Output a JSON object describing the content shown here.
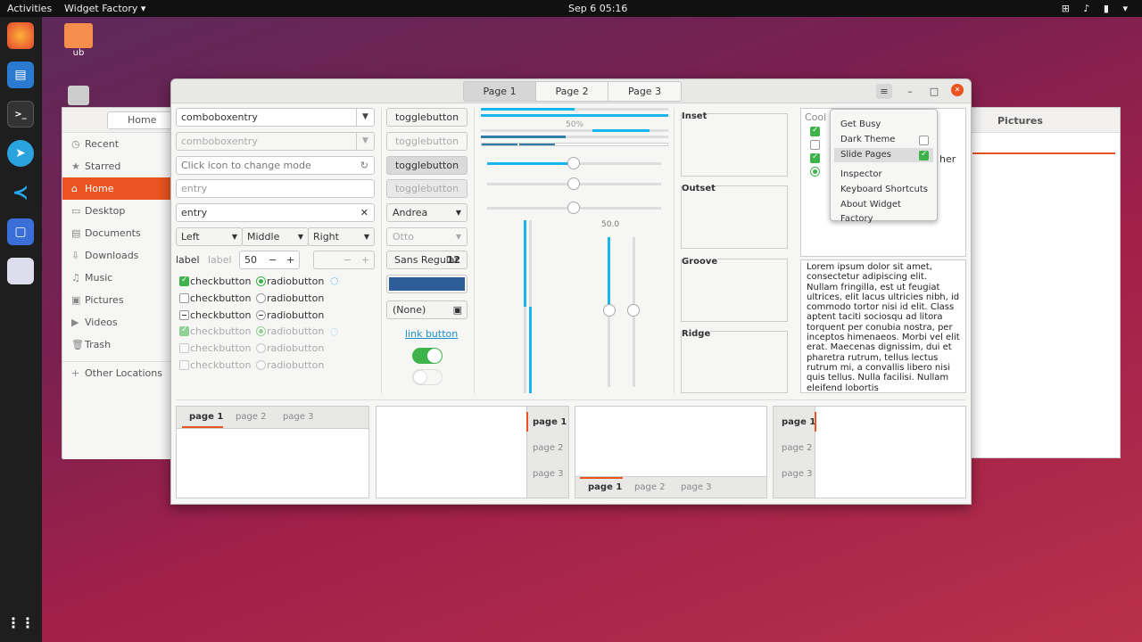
{
  "topbar": {
    "activities": "Activities",
    "app": "Widget Factory ▾",
    "clock": "Sep 6  05:16",
    "tray": "⊞ ♪ ▮ ▾"
  },
  "desktop": {
    "folder_label": "ub"
  },
  "nautilus": {
    "path": "Home",
    "tab": "Pictures",
    "sidebar": [
      "Recent",
      "Starred",
      "Home",
      "Desktop",
      "Documents",
      "Downloads",
      "Music",
      "Pictures",
      "Videos",
      "Trash",
      "Other Locations"
    ]
  },
  "window": {
    "tabs": [
      "Page 1",
      "Page 2",
      "Page 3"
    ],
    "menu_icon": "≡",
    "minimize": "–",
    "maximize": "□",
    "close": "✕"
  },
  "col1": {
    "combo1": "comboboxentry",
    "combo2": "comboboxentry",
    "iconentry": "Click icon to change mode",
    "entry_ph": "entry",
    "entry_val": "entry",
    "seg": [
      "Left",
      "Middle",
      "Right"
    ],
    "label1": "label",
    "label2": "label",
    "spin": "50",
    "spin_minus": "−",
    "spin_plus": "+",
    "checks": [
      "checkbutton",
      "checkbutton",
      "checkbutton",
      "checkbutton",
      "checkbutton",
      "checkbutton"
    ],
    "radios": [
      "radiobutton",
      "radiobutton",
      "radiobutton",
      "radiobutton",
      "radiobutton",
      "radiobutton"
    ]
  },
  "col2": {
    "toggles": [
      "togglebutton",
      "togglebutton",
      "togglebutton",
      "togglebutton"
    ],
    "combo_andrea": "Andrea",
    "combo_otto": "Otto",
    "font": "Sans Regular",
    "font_size": "12",
    "file": "(None)",
    "link": "link button",
    "color": "#2e5e9a"
  },
  "col3": {
    "progress_label": "50%",
    "scale_value": "50.0",
    "progress": [
      0.5,
      1.0,
      0.75,
      0.45
    ],
    "scales": [
      0.45,
      0.45,
      0.45
    ]
  },
  "frames": [
    "Inset",
    "Outset",
    "Groove",
    "Ridge"
  ],
  "list": {
    "title": "Cool",
    "partial": "her"
  },
  "menu": {
    "items": [
      "Get Busy",
      "Dark Theme",
      "Slide Pages",
      "Inspector",
      "Keyboard Shortcuts",
      "About Widget Factory"
    ]
  },
  "text": "Lorem ipsum dolor sit amet, consectetur adipiscing elit. Nullam fringilla, est ut feugiat ultrices, elit lacus ultricies nibh, id commodo tortor nisi id elit. Class aptent taciti sociosqu ad litora torquent per conubia nostra, per inceptos himenaeos. Morbi vel elit erat. Maecenas dignissim, dui et pharetra rutrum, tellus lectus rutrum mi, a convallis libero nisi quis tellus. Nulla facilisi. Nullam eleifend lobortis",
  "notebooks": [
    "page 1",
    "page 2",
    "page 3"
  ],
  "colors": {
    "accent": "#e95420",
    "blue": "#19b6ee",
    "green": "#3db34a"
  }
}
